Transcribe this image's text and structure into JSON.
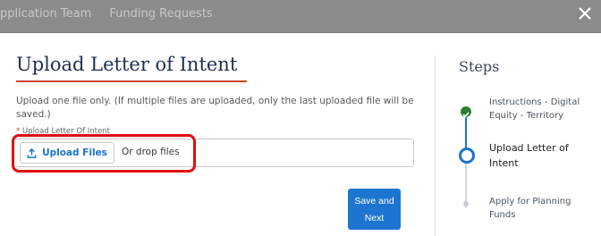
{
  "background_header": {
    "tabs": [
      "pplication Team",
      "Funding Requests"
    ]
  },
  "modal": {
    "title": "Upload Letter of Intent",
    "description": "Upload one file only.  (If multiple files are uploaded, only the last uploaded file will be saved.)",
    "field": {
      "required_marker": "*",
      "label": "Upload Letter Of Intent",
      "upload_button_label": "Upload Files",
      "drop_text": "Or drop files"
    },
    "save_button": {
      "line1": "Save and",
      "line2": "Next"
    }
  },
  "steps": {
    "title": "Steps",
    "items": [
      {
        "label": "Instructions - Digital Equity - Territory",
        "status": "complete"
      },
      {
        "label": "Upload Letter of Intent",
        "status": "current"
      },
      {
        "label": "Apply for Planning Funds",
        "status": "upcoming"
      }
    ]
  },
  "colors": {
    "accent": "#1a73c9",
    "title_underline": "#c9441f",
    "highlight": "#e01010",
    "complete": "#2e7d32"
  }
}
